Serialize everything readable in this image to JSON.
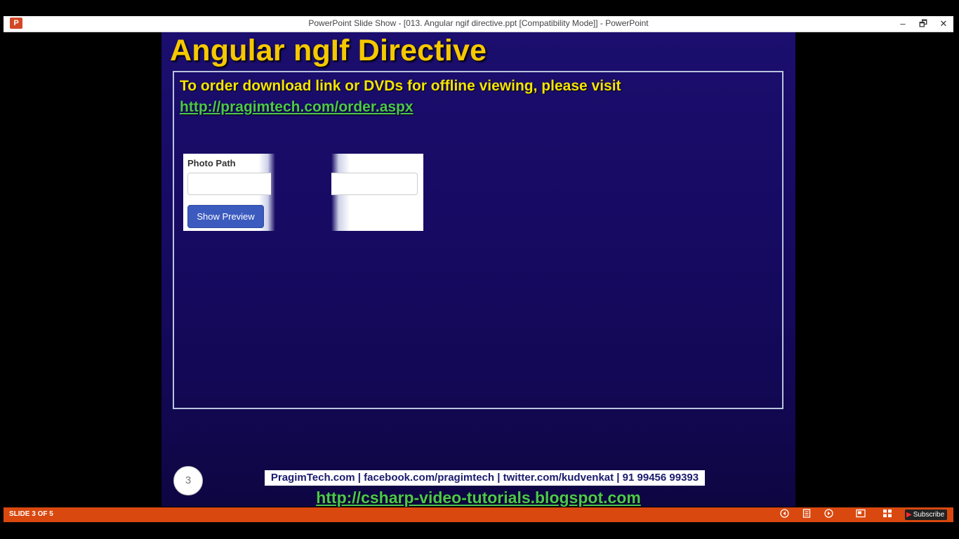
{
  "window": {
    "title": "PowerPoint Slide Show - [013. Angular ngif directive.ppt [Compatibility Mode]] - PowerPoint",
    "app_icon_letter": "P",
    "minimize": "–",
    "restore": "🗗",
    "close": "✕"
  },
  "slide": {
    "title": "Angular ngIf Directive",
    "order_text": "To order download link or DVDs for offline viewing, please visit",
    "order_link": "http://pragimtech.com/order.aspx",
    "demo": {
      "photo_path_label": "Photo Path",
      "photo_path_value": "",
      "show_preview_button": "Show Preview"
    },
    "slide_number": "3",
    "footer_contacts": "PragimTech.com | facebook.com/pragimtech  | twitter.com/kudvenkat  | 91 99456 99393",
    "footer_link": "http://csharp-video-tutorials.blogspot.com"
  },
  "statusbar": {
    "slide_counter": "SLIDE 3 OF 5",
    "subscribe_label": "Subscribe",
    "icons": [
      "previous-icon",
      "notes-icon",
      "next-icon",
      "reading-view-icon",
      "slide-sorter-icon"
    ]
  },
  "colors": {
    "title_yellow": "#f5c800",
    "link_green": "#4cc84c",
    "statusbar_orange": "#d9480f",
    "button_blue": "#3c5bbf"
  }
}
